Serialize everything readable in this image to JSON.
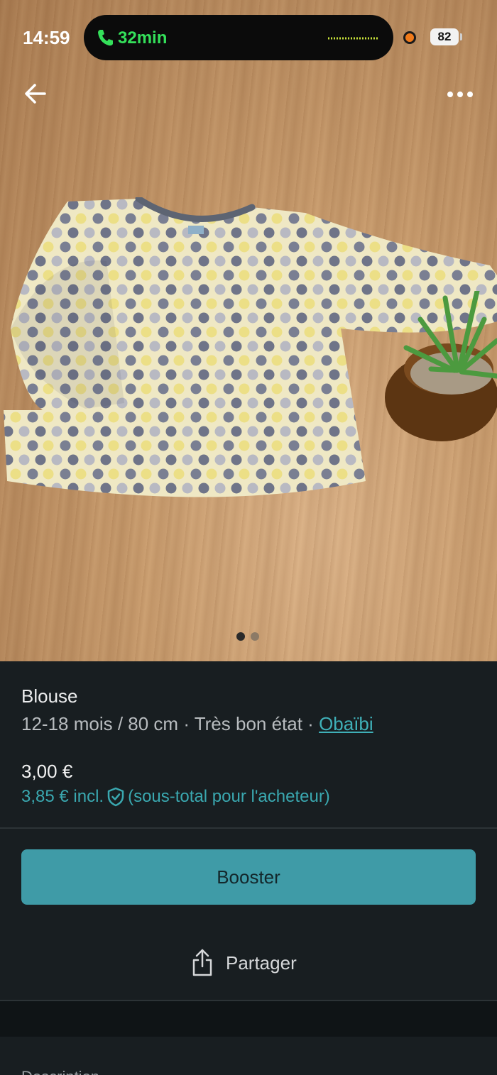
{
  "status_bar": {
    "time": "14:59",
    "call_duration": "32min",
    "battery": "82"
  },
  "nav": {
    "back_icon": "arrow-left-icon",
    "more_icon": "more-horizontal-icon"
  },
  "gallery": {
    "image_count": 2,
    "active_index": 0
  },
  "item": {
    "title": "Blouse",
    "meta_prefix": "12-18 mois / 80 cm · Très bon état · ",
    "brand": "Obaïbi",
    "price": "3,00 €",
    "price_incl": "3,85 € incl.",
    "price_incl_note": "(sous-total pour l'acheteur)"
  },
  "actions": {
    "booster_label": "Booster",
    "share_label": "Partager"
  },
  "description": {
    "heading": "Description"
  },
  "colors": {
    "accent": "#3f9ba7",
    "link": "#3aa8b0",
    "background": "#181e21",
    "call_green": "#34e05a"
  }
}
